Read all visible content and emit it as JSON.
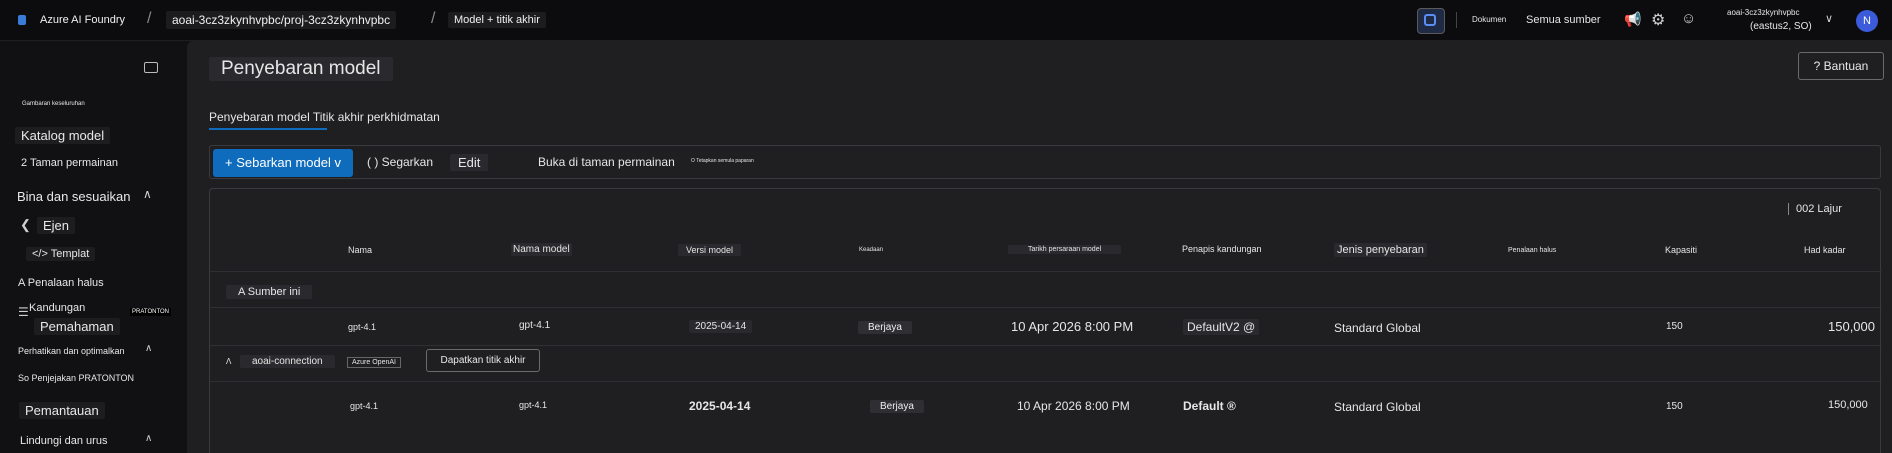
{
  "topbar": {
    "brand": "Azure AI Foundry",
    "crumb_resource": "aoai-3cz3zkynhvpbc/proj-3cz3zkynhvpbc",
    "crumb_page": "Model + titik akhir",
    "docs_label": "Dokumen",
    "all_resources_label": "Semua sumber",
    "account_name": "aoai-3cz3zkynhvpbc",
    "account_region": "(eastus2, SO)",
    "avatar_initial": "N"
  },
  "sidebar": {
    "overview_label": "Gambaran keseluruhan",
    "catalog_label": "Katalog model",
    "playground_label": "2 Taman permainan",
    "build_section_label": "Bina dan sesuaikan",
    "agents_label": "Ejen",
    "templates_label": "</> Templat",
    "finetune_label": "A Penalaan halus",
    "content_label": "Kandungan",
    "content_badge": "PRATONTON",
    "understanding_label": "Pemahaman",
    "observe_section_label": "Perhatikan dan optimalkan",
    "tracing_label": "So Penjejakan PRATONTON",
    "monitoring_label": "Pemantauan",
    "protect_section_label": "Lindungi dan urus"
  },
  "main": {
    "page_title": "Penyebaran model",
    "help_label": "? Bantuan",
    "tab_label": "Penyebaran model Titik akhir perkhidmatan",
    "toolbar": {
      "deploy_label": "+ Sebarkan model v",
      "refresh_label": "( ) Segarkan",
      "edit_label": "Edit",
      "open_playground_label": "Buka di taman permainan",
      "columns_label": "O Tetapkan semula paparan"
    },
    "rows_count_label": "002 Lajur",
    "table": {
      "headers": [
        "Nama",
        "Nama model",
        "Versi model",
        "Keadaan",
        "Tarikh persaraan model",
        "Penapis kandungan",
        "Jenis penyebaran",
        "Penalaan halus",
        "Kapasiti",
        "Had kadar"
      ],
      "group_label": "A Sumber ini",
      "connection_label": "aoai-connection",
      "connection_type": "Azure OpenAI",
      "get_endpoint_label": "Dapatkan titik akhir",
      "rows": [
        {
          "name": "gpt-4.1",
          "model": "gpt-4.1",
          "version": "2025-04-14",
          "status": "Berjaya",
          "retire": "10 Apr 2026 8:00 PM",
          "filter": "DefaultV2 @",
          "type": "Standard Global",
          "capacity": "150",
          "rate": "150,000"
        },
        {
          "name": "gpt-4.1",
          "model": "gpt-4.1",
          "version": "2025-04-14",
          "status": "Berjaya",
          "retire": "10 Apr 2026 8:00 PM",
          "filter": "Default ®",
          "type": "Standard Global",
          "capacity": "150",
          "rate": "150,000"
        }
      ]
    }
  },
  "colors": {
    "accent": "#0f6cbd",
    "avatar": "#3b5bdb",
    "bg": "#111113",
    "panel": "#1f1f22"
  }
}
